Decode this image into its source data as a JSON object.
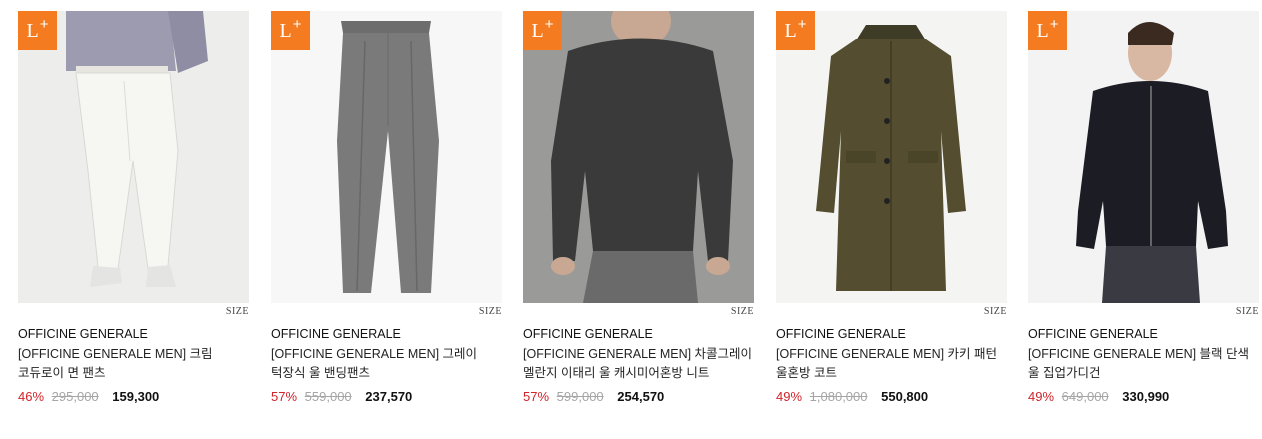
{
  "badge": "L",
  "size_label": "SIZE",
  "products": [
    {
      "brand": "OFFICINE GENERALE",
      "name": "[OFFICINE GENERALE MEN] 크림 코듀로이 면 팬츠",
      "discount": "46%",
      "original_price": "295,000",
      "sale_price": "159,300",
      "item": "cream-corduroy-pants"
    },
    {
      "brand": "OFFICINE GENERALE",
      "name": "[OFFICINE GENERALE MEN] 그레이 턱장식 울 밴딩팬츠",
      "discount": "57%",
      "original_price": "559,000",
      "sale_price": "237,570",
      "item": "grey-wool-pants"
    },
    {
      "brand": "OFFICINE GENERALE",
      "name": "[OFFICINE GENERALE MEN] 차콜그레이 멜란지 이태리 울 캐시미어혼방 니트",
      "discount": "57%",
      "original_price": "599,000",
      "sale_price": "254,570",
      "item": "charcoal-knit"
    },
    {
      "brand": "OFFICINE GENERALE",
      "name": "[OFFICINE GENERALE MEN] 카키 패턴 울혼방 코트",
      "discount": "49%",
      "original_price": "1,080,000",
      "sale_price": "550,800",
      "item": "khaki-coat"
    },
    {
      "brand": "OFFICINE GENERALE",
      "name": "[OFFICINE GENERALE MEN] 블랙 단색 울 집업가디건",
      "discount": "49%",
      "original_price": "649,000",
      "sale_price": "330,990",
      "item": "black-zip-cardigan"
    }
  ],
  "colors": {
    "badge": "#f57b20",
    "discount": "#d2232a",
    "original_price": "#a6a6a6"
  }
}
